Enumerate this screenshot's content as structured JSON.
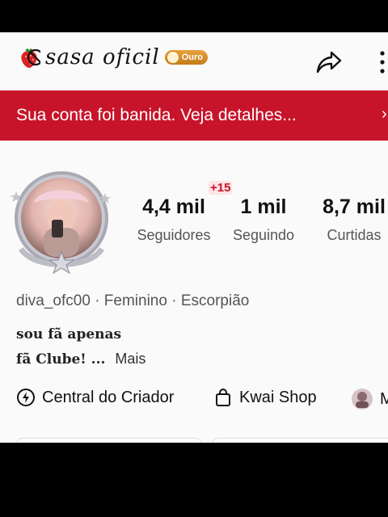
{
  "profile": {
    "name": "sasa oficil",
    "badge_label": "Ouro",
    "username": "diva_ofc00",
    "gender": "Feminino",
    "sign": "Escorpião",
    "bio_line1": "sou fã apenas",
    "bio_line2": "fã Clube! ...",
    "bio_more": "Mais"
  },
  "banner": {
    "text": "Sua conta foi banida. Veja detalhes...",
    "arrow": "›"
  },
  "stats": {
    "new_followers": "+15",
    "followers_value": "4,4 mil",
    "followers_label": "Seguidores",
    "following_value": "1 mil",
    "following_label": "Seguindo",
    "likes_value": "8,7 mil",
    "likes_label": "Curtidas"
  },
  "tools": {
    "creator_center": "Central do Criador",
    "kwai_shop": "Kwai Shop",
    "third_partial": "M"
  },
  "colors": {
    "ban_red": "#c8142a",
    "badge_gold": "#d08a20"
  },
  "icons": [
    "strawberry-icon",
    "badge-coin-icon",
    "share-icon",
    "more-vertical-icon",
    "avatar-frame",
    "creator-center-icon",
    "shopping-bag-icon"
  ]
}
